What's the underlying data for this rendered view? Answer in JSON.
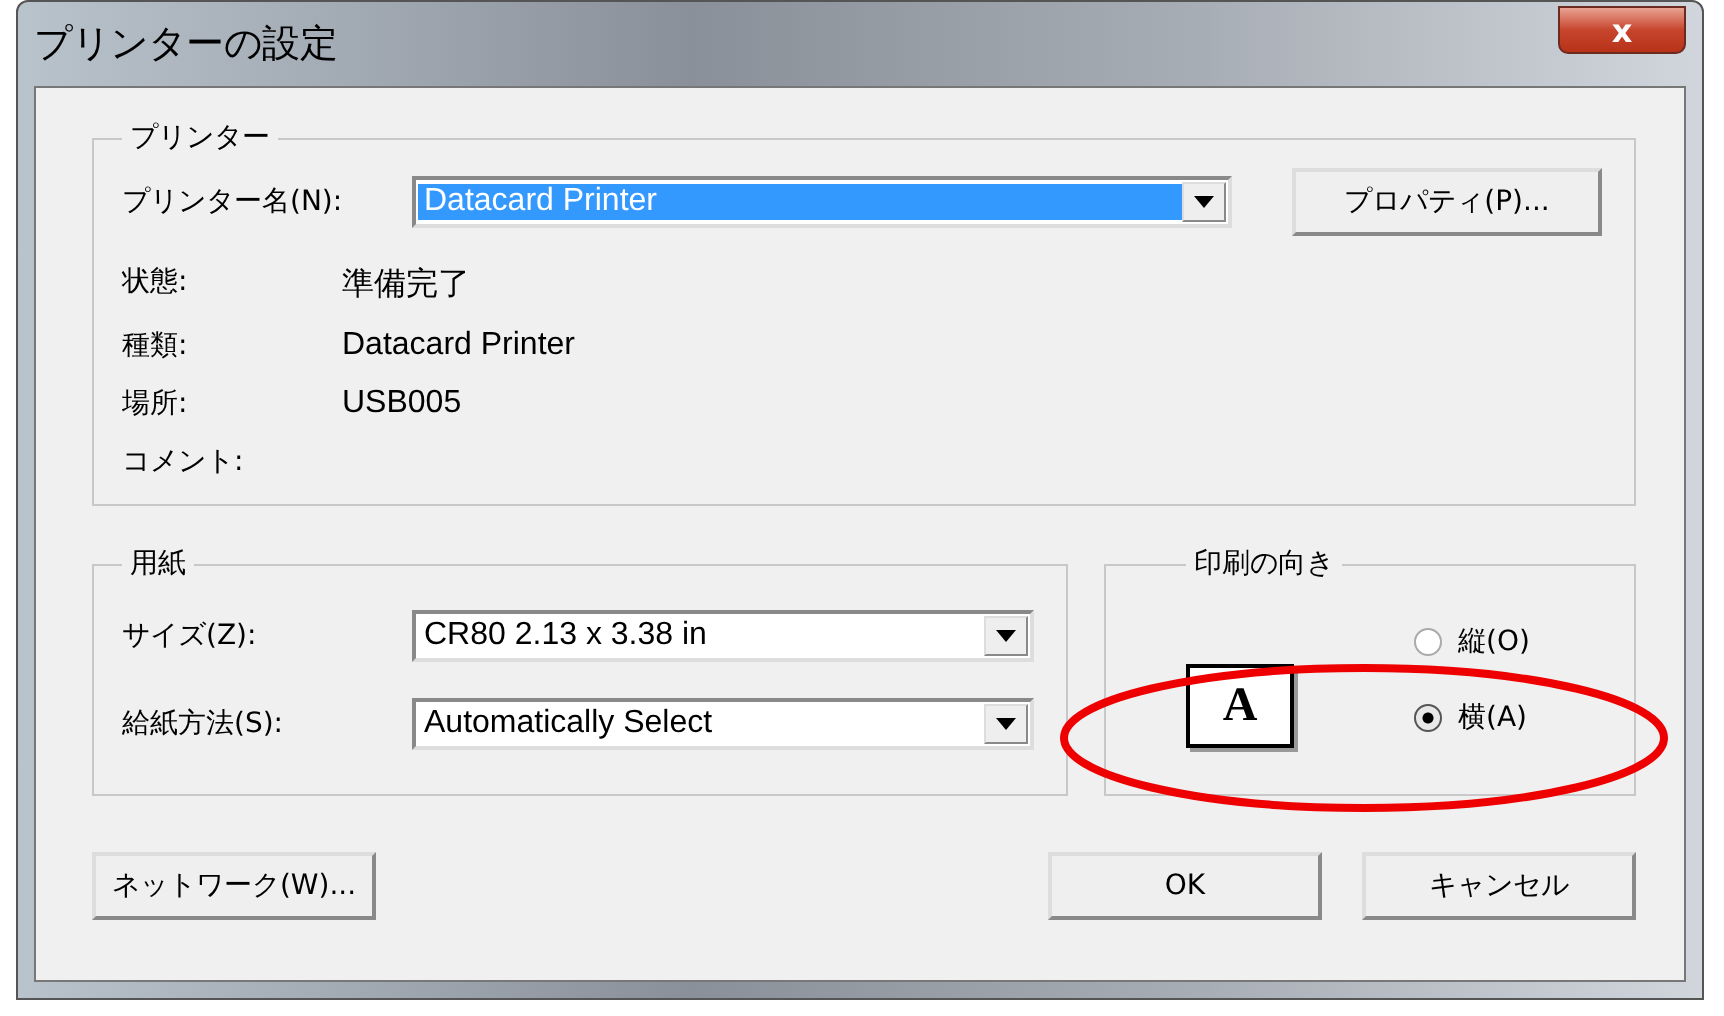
{
  "window": {
    "title": "プリンターの設定",
    "close": "x"
  },
  "printer": {
    "legend": "プリンター",
    "name_label": "プリンター名(N):",
    "name_value": "Datacard Printer",
    "properties_button": "プロパティ(P)...",
    "info": [
      {
        "label": "状態:",
        "value": "準備完了"
      },
      {
        "label": "種類:",
        "value": "Datacard Printer"
      },
      {
        "label": "場所:",
        "value": "USB005"
      },
      {
        "label": "コメント:"
      }
    ]
  },
  "paper": {
    "legend": "用紙",
    "fields": [
      {
        "label": "サイズ(Z):",
        "value": "CR80 2.13 x 3.38 in"
      },
      {
        "label": "給紙方法(S):",
        "value": "Automatically Select"
      }
    ]
  },
  "orientation": {
    "legend": "印刷の向き",
    "preview_letter": "A",
    "options": [
      {
        "label": "縦(O)",
        "selected": false
      },
      {
        "label": "横(A)",
        "selected": true
      }
    ]
  },
  "buttons": {
    "network": "ネットワーク(W)...",
    "ok": "OK",
    "cancel": "キャンセル"
  }
}
